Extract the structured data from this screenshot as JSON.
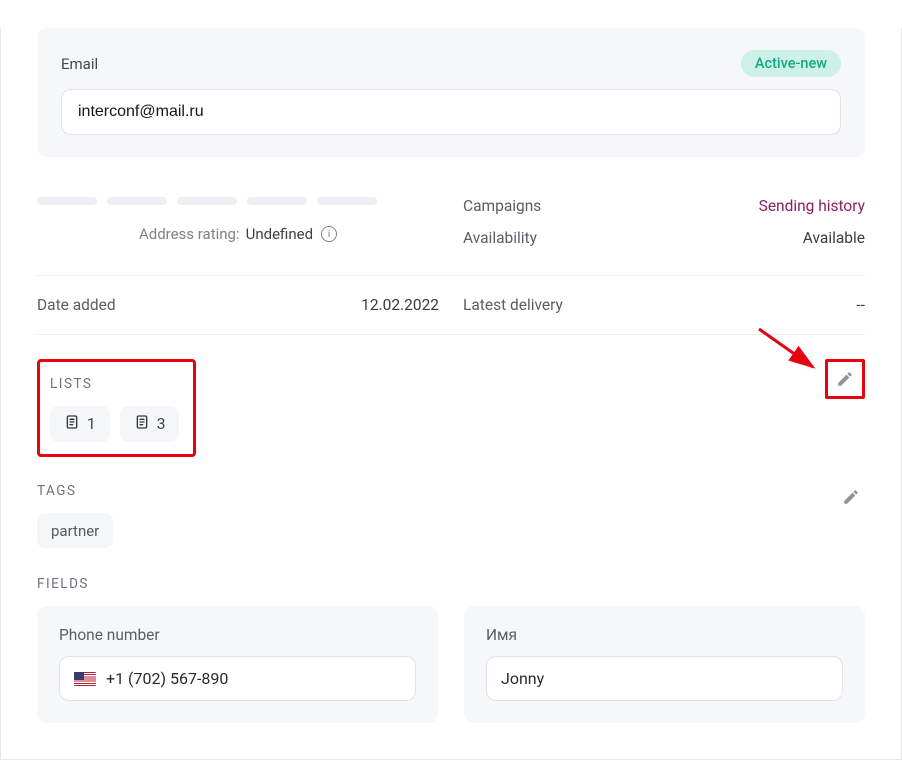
{
  "email": {
    "label": "Email",
    "value": "interconf@mail.ru",
    "status": "Active-new"
  },
  "rating": {
    "label": "Address rating:",
    "value": "Undefined"
  },
  "campaigns": {
    "label": "Campaigns",
    "history_link": "Sending history"
  },
  "availability": {
    "label": "Availability",
    "value": "Available"
  },
  "date_added": {
    "label": "Date added",
    "value": "12.02.2022"
  },
  "latest_delivery": {
    "label": "Latest delivery",
    "value": "--"
  },
  "lists": {
    "title": "LISTS",
    "items": [
      {
        "label": "1"
      },
      {
        "label": "3"
      }
    ]
  },
  "tags": {
    "title": "TAGS",
    "items": [
      {
        "label": "partner"
      }
    ]
  },
  "fields": {
    "title": "FIELDS",
    "phone": {
      "label": "Phone number",
      "value": "+1 (702) 567-890",
      "country": "US"
    },
    "name": {
      "label": "Имя",
      "value": "Jonny"
    }
  },
  "colors": {
    "accent_purple": "#8a1e63",
    "status_green_bg": "#cdf1e6",
    "status_green_text": "#17a589",
    "highlight_red": "#e6040f"
  }
}
